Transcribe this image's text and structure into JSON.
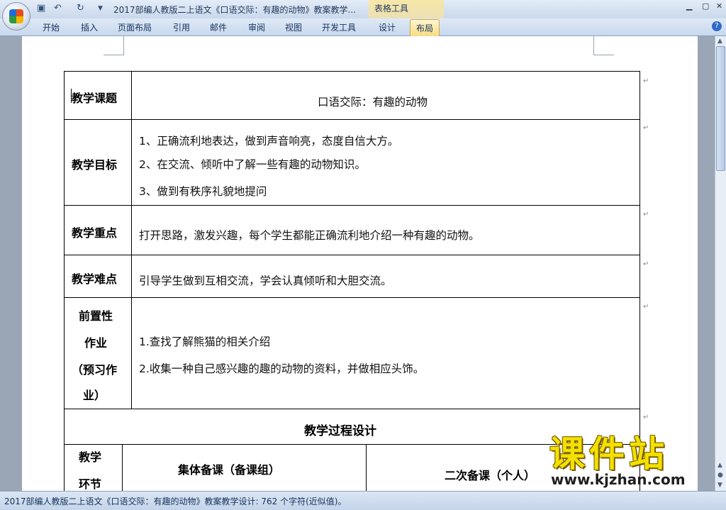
{
  "window": {
    "title": "2017部编人教版二上语文《口语交际：有趣的动物》教案教学...",
    "context_tab_group": "表格工具"
  },
  "ribbon": {
    "tabs": [
      "开始",
      "插入",
      "页面布局",
      "引用",
      "邮件",
      "审阅",
      "视图",
      "开发工具",
      "设计",
      "布局"
    ],
    "active_tab": "布局"
  },
  "document": {
    "rows": [
      {
        "label": "教学课题",
        "lines": [
          "口语交际：有趣的动物"
        ]
      },
      {
        "label": "教学目标",
        "lines": [
          "1、正确流利地表达，做到声音响亮，态度自信大方。",
          "2、在交流、倾听中了解一些有趣的动物知识。",
          "3、做到有秩序礼貌地提问"
        ]
      },
      {
        "label": "教学重点",
        "lines": [
          "打开思路，激发兴趣，每个学生都能正确流利地介绍一种有趣的动物。"
        ]
      },
      {
        "label": "教学难点",
        "lines": [
          "引导学生做到互相交流，学会认真倾听和大胆交流。"
        ]
      },
      {
        "label_lines": [
          "前置性",
          "作业",
          "（预习作",
          "业）"
        ],
        "lines": [
          "1.查找了解熊猫的相关介绍",
          "2.收集一种自己感兴趣的趣的动物的资料，并做相应头饰。"
        ]
      }
    ],
    "section_title": "教学过程设计",
    "sub_header": {
      "col1_lines": [
        "教学",
        "环节"
      ],
      "col2": "集体备课（备课组）",
      "col3": "二次备课（个人）"
    },
    "paragraph_mark": "↵"
  },
  "status_bar": {
    "text": "2017部编人教版二上语文《口语交际：有趣的动物》教案教学设计: 762 个字符(近似值)。"
  },
  "watermark": {
    "title": "课件站",
    "url": "www.kjzhan.com"
  },
  "colors": {
    "ribbon": "#c8d8ee",
    "active_tab": "#f7dc84",
    "watermark": "#f2e100"
  }
}
